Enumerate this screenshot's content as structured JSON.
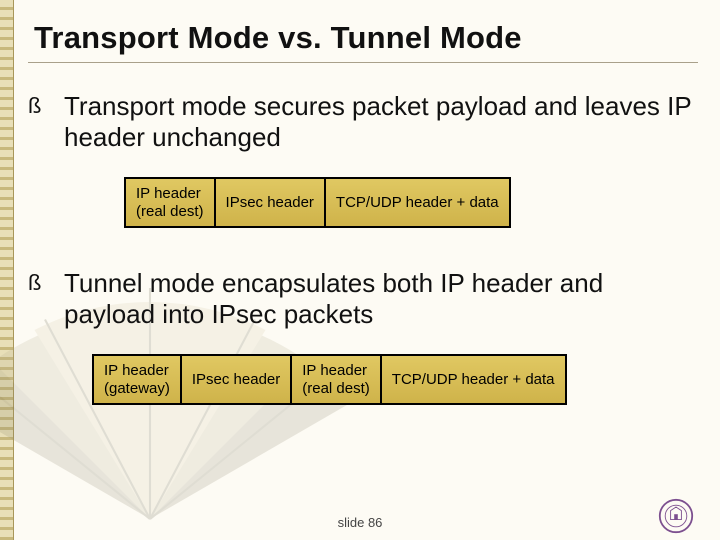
{
  "title": "Transport Mode vs. Tunnel Mode",
  "bullets": [
    "Transport mode secures packet payload and leaves IP header unchanged",
    "Tunnel mode encapsulates both IP header and payload into IPsec packets"
  ],
  "transport_cells": {
    "c1a": "IP header",
    "c1b": "(real dest)",
    "c2": "IPsec header",
    "c3": "TCP/UDP header + data"
  },
  "tunnel_cells": {
    "c1a": "IP header",
    "c1b": "(gateway)",
    "c2": "IPsec header",
    "c3a": "IP header",
    "c3b": "(real dest)",
    "c4": "TCP/UDP header + data"
  },
  "footer": "slide 86"
}
